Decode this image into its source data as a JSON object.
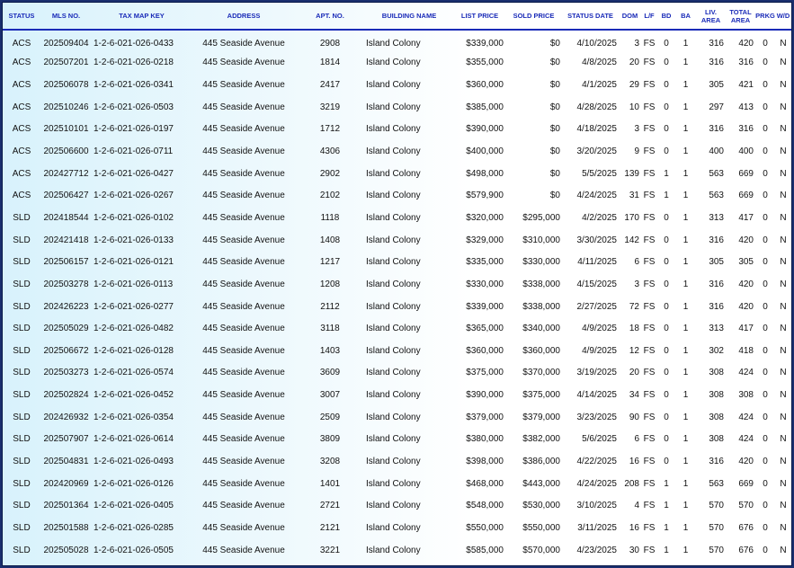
{
  "columns": [
    {
      "key": "status",
      "label": "STATUS"
    },
    {
      "key": "mls",
      "label": "MLS NO."
    },
    {
      "key": "tmk",
      "label": "TAX MAP KEY"
    },
    {
      "key": "address",
      "label": "ADDRESS"
    },
    {
      "key": "apt",
      "label": "APT. NO."
    },
    {
      "key": "building",
      "label": "BUILDING NAME"
    },
    {
      "key": "list_price",
      "label": "LIST PRICE"
    },
    {
      "key": "sold_price",
      "label": "SOLD PRICE"
    },
    {
      "key": "status_date",
      "label": "STATUS DATE"
    },
    {
      "key": "dom",
      "label": "DOM"
    },
    {
      "key": "lf",
      "label": "L/F"
    },
    {
      "key": "bd",
      "label": "BD"
    },
    {
      "key": "ba",
      "label": "BA"
    },
    {
      "key": "liv_area",
      "label": "LIV. AREA"
    },
    {
      "key": "total_area",
      "label": "TOTAL AREA"
    },
    {
      "key": "prkg",
      "label": "PRKG"
    },
    {
      "key": "wd",
      "label": "W/D"
    }
  ],
  "rows": [
    [
      "ACS",
      "202509404",
      "1-2-6-021-026-0433",
      "445 Seaside Avenue",
      "2908",
      "Island Colony",
      "$339,000",
      "$0",
      "4/10/2025",
      "3",
      "FS",
      "0",
      "1",
      "316",
      "420",
      "0",
      "N"
    ],
    [
      "ACS",
      "202507201",
      "1-2-6-021-026-0218",
      "445 Seaside Avenue",
      "1814",
      "Island Colony",
      "$355,000",
      "$0",
      "4/8/2025",
      "20",
      "FS",
      "0",
      "1",
      "316",
      "316",
      "0",
      "N"
    ],
    [
      "ACS",
      "202506078",
      "1-2-6-021-026-0341",
      "445 Seaside Avenue",
      "2417",
      "Island Colony",
      "$360,000",
      "$0",
      "4/1/2025",
      "29",
      "FS",
      "0",
      "1",
      "305",
      "421",
      "0",
      "N"
    ],
    [
      "ACS",
      "202510246",
      "1-2-6-021-026-0503",
      "445 Seaside Avenue",
      "3219",
      "Island Colony",
      "$385,000",
      "$0",
      "4/28/2025",
      "10",
      "FS",
      "0",
      "1",
      "297",
      "413",
      "0",
      "N"
    ],
    [
      "ACS",
      "202510101",
      "1-2-6-021-026-0197",
      "445 Seaside Avenue",
      "1712",
      "Island Colony",
      "$390,000",
      "$0",
      "4/18/2025",
      "3",
      "FS",
      "0",
      "1",
      "316",
      "316",
      "0",
      "N"
    ],
    [
      "ACS",
      "202506600",
      "1-2-6-021-026-0711",
      "445 Seaside Avenue",
      "4306",
      "Island Colony",
      "$400,000",
      "$0",
      "3/20/2025",
      "9",
      "FS",
      "0",
      "1",
      "400",
      "400",
      "0",
      "N"
    ],
    [
      "ACS",
      "202427712",
      "1-2-6-021-026-0427",
      "445 Seaside Avenue",
      "2902",
      "Island Colony",
      "$498,000",
      "$0",
      "5/5/2025",
      "139",
      "FS",
      "1",
      "1",
      "563",
      "669",
      "0",
      "N"
    ],
    [
      "ACS",
      "202506427",
      "1-2-6-021-026-0267",
      "445 Seaside Avenue",
      "2102",
      "Island Colony",
      "$579,900",
      "$0",
      "4/24/2025",
      "31",
      "FS",
      "1",
      "1",
      "563",
      "669",
      "0",
      "N"
    ],
    [
      "SLD",
      "202418544",
      "1-2-6-021-026-0102",
      "445 Seaside Avenue",
      "1118",
      "Island Colony",
      "$320,000",
      "$295,000",
      "4/2/2025",
      "170",
      "FS",
      "0",
      "1",
      "313",
      "417",
      "0",
      "N"
    ],
    [
      "SLD",
      "202421418",
      "1-2-6-021-026-0133",
      "445 Seaside Avenue",
      "1408",
      "Island Colony",
      "$329,000",
      "$310,000",
      "3/30/2025",
      "142",
      "FS",
      "0",
      "1",
      "316",
      "420",
      "0",
      "N"
    ],
    [
      "SLD",
      "202506157",
      "1-2-6-021-026-0121",
      "445 Seaside Avenue",
      "1217",
      "Island Colony",
      "$335,000",
      "$330,000",
      "4/11/2025",
      "6",
      "FS",
      "0",
      "1",
      "305",
      "305",
      "0",
      "N"
    ],
    [
      "SLD",
      "202503278",
      "1-2-6-021-026-0113",
      "445 Seaside Avenue",
      "1208",
      "Island Colony",
      "$330,000",
      "$338,000",
      "4/15/2025",
      "3",
      "FS",
      "0",
      "1",
      "316",
      "420",
      "0",
      "N"
    ],
    [
      "SLD",
      "202426223",
      "1-2-6-021-026-0277",
      "445 Seaside Avenue",
      "2112",
      "Island Colony",
      "$339,000",
      "$338,000",
      "2/27/2025",
      "72",
      "FS",
      "0",
      "1",
      "316",
      "420",
      "0",
      "N"
    ],
    [
      "SLD",
      "202505029",
      "1-2-6-021-026-0482",
      "445 Seaside Avenue",
      "3118",
      "Island Colony",
      "$365,000",
      "$340,000",
      "4/9/2025",
      "18",
      "FS",
      "0",
      "1",
      "313",
      "417",
      "0",
      "N"
    ],
    [
      "SLD",
      "202506672",
      "1-2-6-021-026-0128",
      "445 Seaside Avenue",
      "1403",
      "Island Colony",
      "$360,000",
      "$360,000",
      "4/9/2025",
      "12",
      "FS",
      "0",
      "1",
      "302",
      "418",
      "0",
      "N"
    ],
    [
      "SLD",
      "202503273",
      "1-2-6-021-026-0574",
      "445 Seaside Avenue",
      "3609",
      "Island Colony",
      "$375,000",
      "$370,000",
      "3/19/2025",
      "20",
      "FS",
      "0",
      "1",
      "308",
      "424",
      "0",
      "N"
    ],
    [
      "SLD",
      "202502824",
      "1-2-6-021-026-0452",
      "445 Seaside Avenue",
      "3007",
      "Island Colony",
      "$390,000",
      "$375,000",
      "4/14/2025",
      "34",
      "FS",
      "0",
      "1",
      "308",
      "308",
      "0",
      "N"
    ],
    [
      "SLD",
      "202426932",
      "1-2-6-021-026-0354",
      "445 Seaside Avenue",
      "2509",
      "Island Colony",
      "$379,000",
      "$379,000",
      "3/23/2025",
      "90",
      "FS",
      "0",
      "1",
      "308",
      "424",
      "0",
      "N"
    ],
    [
      "SLD",
      "202507907",
      "1-2-6-021-026-0614",
      "445 Seaside Avenue",
      "3809",
      "Island Colony",
      "$380,000",
      "$382,000",
      "5/6/2025",
      "6",
      "FS",
      "0",
      "1",
      "308",
      "424",
      "0",
      "N"
    ],
    [
      "SLD",
      "202504831",
      "1-2-6-021-026-0493",
      "445 Seaside Avenue",
      "3208",
      "Island Colony",
      "$398,000",
      "$386,000",
      "4/22/2025",
      "16",
      "FS",
      "0",
      "1",
      "316",
      "420",
      "0",
      "N"
    ],
    [
      "SLD",
      "202420969",
      "1-2-6-021-026-0126",
      "445 Seaside Avenue",
      "1401",
      "Island Colony",
      "$468,000",
      "$443,000",
      "4/24/2025",
      "208",
      "FS",
      "1",
      "1",
      "563",
      "669",
      "0",
      "N"
    ],
    [
      "SLD",
      "202501364",
      "1-2-6-021-026-0405",
      "445 Seaside Avenue",
      "2721",
      "Island Colony",
      "$548,000",
      "$530,000",
      "3/10/2025",
      "4",
      "FS",
      "1",
      "1",
      "570",
      "570",
      "0",
      "N"
    ],
    [
      "SLD",
      "202501588",
      "1-2-6-021-026-0285",
      "445 Seaside Avenue",
      "2121",
      "Island Colony",
      "$550,000",
      "$550,000",
      "3/11/2025",
      "16",
      "FS",
      "1",
      "1",
      "570",
      "676",
      "0",
      "N"
    ],
    [
      "SLD",
      "202505028",
      "1-2-6-021-026-0505",
      "445 Seaside Avenue",
      "3221",
      "Island Colony",
      "$585,000",
      "$570,000",
      "4/23/2025",
      "30",
      "FS",
      "1",
      "1",
      "570",
      "676",
      "0",
      "N"
    ]
  ]
}
